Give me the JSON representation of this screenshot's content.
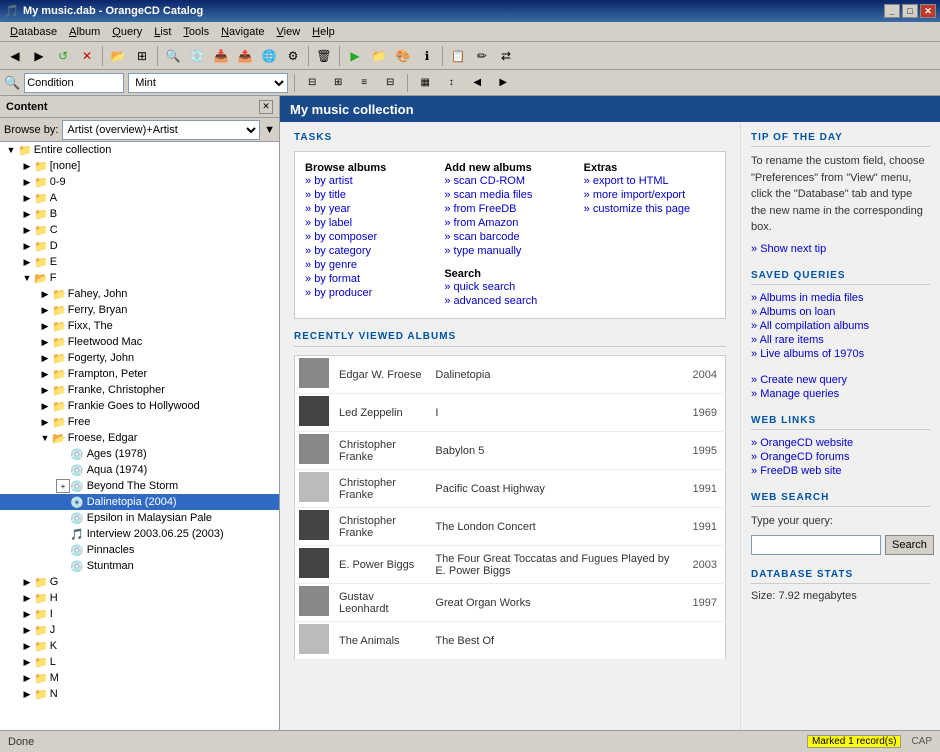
{
  "window": {
    "title": "My music.dab - OrangeCD Catalog",
    "icon": "🎵"
  },
  "titlebar": {
    "title": "My music.dab - OrangeCD Catalog",
    "min_label": "_",
    "max_label": "□",
    "close_label": "✕"
  },
  "menubar": {
    "items": [
      "Database",
      "Album",
      "Query",
      "List",
      "Tools",
      "Navigate",
      "View",
      "Help"
    ]
  },
  "toolbar2": {
    "condition_label": "Condition",
    "condition_value": "Mint",
    "browse_label": "Browse by:"
  },
  "left_panel": {
    "title": "Content",
    "browse_label": "Browse by:",
    "browse_value": "Artist (overview)+Artist",
    "tree": {
      "root": "Entire collection",
      "items": [
        {
          "label": "[none]",
          "level": 1,
          "expanded": false
        },
        {
          "label": "0-9",
          "level": 1,
          "expanded": false
        },
        {
          "label": "A",
          "level": 1,
          "expanded": false
        },
        {
          "label": "B",
          "level": 1,
          "expanded": false
        },
        {
          "label": "C",
          "level": 1,
          "expanded": false
        },
        {
          "label": "D",
          "level": 1,
          "expanded": false
        },
        {
          "label": "E",
          "level": 1,
          "expanded": false
        },
        {
          "label": "F",
          "level": 1,
          "expanded": true
        },
        {
          "label": "Fahey, John",
          "level": 2,
          "expanded": false
        },
        {
          "label": "Ferry, Bryan",
          "level": 2,
          "expanded": false
        },
        {
          "label": "Fixx, The",
          "level": 2,
          "expanded": false
        },
        {
          "label": "Fleetwood Mac",
          "level": 2,
          "expanded": false
        },
        {
          "label": "Fogerty, John",
          "level": 2,
          "expanded": false
        },
        {
          "label": "Frampton, Peter",
          "level": 2,
          "expanded": false
        },
        {
          "label": "Franke, Christopher",
          "level": 2,
          "expanded": false
        },
        {
          "label": "Frankie Goes to Hollywood",
          "level": 2,
          "expanded": false
        },
        {
          "label": "Free",
          "level": 2,
          "expanded": false
        },
        {
          "label": "Froese, Edgar",
          "level": 2,
          "expanded": true
        },
        {
          "label": "Ages (1978)",
          "level": 3,
          "is_album": true
        },
        {
          "label": "Aqua (1974)",
          "level": 3,
          "is_album": true
        },
        {
          "label": "Beyond The Storm",
          "level": 3,
          "is_album": true,
          "expanded": true
        },
        {
          "label": "Dalinetopia (2004)",
          "level": 3,
          "is_album": true,
          "selected": true
        },
        {
          "label": "Epsilon in Malaysian Pale",
          "level": 3,
          "is_album": true
        },
        {
          "label": "Interview 2003.06.25 (2003)",
          "level": 3,
          "is_album": true
        },
        {
          "label": "Pinnacles",
          "level": 3,
          "is_album": true
        },
        {
          "label": "Stuntman",
          "level": 3,
          "is_album": true
        },
        {
          "label": "G",
          "level": 1,
          "expanded": false
        },
        {
          "label": "H",
          "level": 1,
          "expanded": false
        },
        {
          "label": "I",
          "level": 1,
          "expanded": false
        },
        {
          "label": "J",
          "level": 1,
          "expanded": false
        },
        {
          "label": "K",
          "level": 1,
          "expanded": false
        },
        {
          "label": "L",
          "level": 1,
          "expanded": false
        },
        {
          "label": "M",
          "level": 1,
          "expanded": false
        },
        {
          "label": "N",
          "level": 1,
          "expanded": false
        }
      ]
    }
  },
  "right_panel": {
    "title": "My music collection",
    "tasks": {
      "section_title": "TASKS",
      "browse_col": {
        "heading": "Browse albums",
        "links": [
          "by artist",
          "by title",
          "by year",
          "by label",
          "by composer",
          "by category",
          "by genre",
          "by format",
          "by producer"
        ]
      },
      "add_col": {
        "heading": "Add new albums",
        "links": [
          "scan CD-ROM",
          "scan media files",
          "from FreeDB",
          "from Amazon",
          "scan barcode",
          "type manually"
        ]
      },
      "search_col": {
        "heading": "Search",
        "links": [
          "quick search",
          "advanced search"
        ]
      },
      "extras_col": {
        "heading": "Extras",
        "links": [
          "export to HTML",
          "more import/export",
          "customize this page"
        ]
      }
    },
    "recent_section_title": "RECENTLY VIEWED ALBUMS",
    "recent_albums": [
      {
        "artist": "Edgar W. Froese",
        "title": "Dalinetopia",
        "year": "2004",
        "thumb_color": "med"
      },
      {
        "artist": "Led Zeppelin",
        "title": "I",
        "year": "1969",
        "thumb_color": "dark"
      },
      {
        "artist": "Christopher Franke",
        "title": "Babylon 5",
        "year": "1995",
        "thumb_color": "med"
      },
      {
        "artist": "Christopher Franke",
        "title": "Pacific Coast Highway",
        "year": "1991",
        "thumb_color": "light"
      },
      {
        "artist": "Christopher Franke",
        "title": "The London Concert",
        "year": "1991",
        "thumb_color": "dark"
      },
      {
        "artist": "E. Power Biggs",
        "title": "The Four Great Toccatas and Fugues Played by E. Power Biggs",
        "year": "2003",
        "thumb_color": "dark"
      },
      {
        "artist": "Gustav Leonhardt",
        "title": "Great Organ Works",
        "year": "1997",
        "thumb_color": "med"
      },
      {
        "artist": "The Animals",
        "title": "The Best Of",
        "year": "",
        "thumb_color": "light"
      }
    ]
  },
  "right_sidebar": {
    "tip_section": {
      "title": "TIP OF THE DAY",
      "text": "To rename the custom field, choose \"Preferences\" from \"View\" menu, click the \"Database\" tab and type the new name in the corresponding box.",
      "show_next": "Show next tip"
    },
    "saved_queries": {
      "title": "SAVED QUERIES",
      "links": [
        "Albums in media files",
        "Albums on loan",
        "All compilation albums",
        "All rare items",
        "Live albums of 1970s"
      ],
      "extra_links": [
        "Create new query",
        "Manage queries"
      ]
    },
    "web_links": {
      "title": "WEB LINKS",
      "links": [
        "OrangeCD website",
        "OrangeCD forums",
        "FreeDB web site"
      ]
    },
    "web_search": {
      "title": "WEB SEARCH",
      "label": "Type your query:",
      "placeholder": "",
      "button": "Search"
    },
    "db_stats": {
      "title": "DATABASE STATS",
      "size_label": "Size: 7.92 megabytes"
    }
  },
  "status_bar": {
    "left": "Done",
    "marked": "Marked 1 record(s)",
    "caps": "CAP"
  }
}
